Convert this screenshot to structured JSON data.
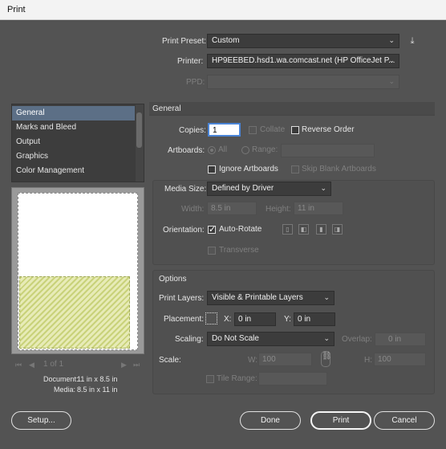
{
  "window": {
    "title": "Print"
  },
  "header": {
    "print_preset_label": "Print Preset:",
    "print_preset_value": "Custom",
    "printer_label": "Printer:",
    "printer_value": "HP9EEBED.hsd1.wa.comcast.net (HP OfficeJet P...",
    "ppd_label": "PPD:",
    "ppd_value": ""
  },
  "sidebar": {
    "items": [
      {
        "label": "General",
        "selected": true
      },
      {
        "label": "Marks and Bleed"
      },
      {
        "label": "Output"
      },
      {
        "label": "Graphics"
      },
      {
        "label": "Color Management"
      }
    ]
  },
  "preview": {
    "page_nav": "1 of 1",
    "document_label": "Document:",
    "document_value": "11 in x 8.5 in",
    "media_label": "Media:",
    "media_value": "8.5 in x 11 in"
  },
  "general": {
    "section_title": "General",
    "copies_label": "Copies:",
    "copies_value": "1",
    "collate_label": "Collate",
    "reverse_order_label": "Reverse Order",
    "artboards_label": "Artboards:",
    "all_label": "All",
    "range_label": "Range:",
    "ignore_artboards_label": "Ignore Artboards",
    "skip_blank_label": "Skip Blank Artboards",
    "media_size_label": "Media Size:",
    "media_size_value": "Defined by Driver",
    "width_label": "Width:",
    "width_value": "8.5 in",
    "height_label": "Height:",
    "height_value": "11 in",
    "orientation_label": "Orientation:",
    "auto_rotate_label": "Auto-Rotate",
    "transverse_label": "Transverse"
  },
  "options": {
    "section_title": "Options",
    "print_layers_label": "Print Layers:",
    "print_layers_value": "Visible & Printable Layers",
    "placement_label": "Placement:",
    "x_label": "X:",
    "x_value": "0 in",
    "y_label": "Y:",
    "y_value": "0 in",
    "scaling_label": "Scaling:",
    "scaling_value": "Do Not Scale",
    "overlap_label": "Overlap:",
    "overlap_value": "0 in",
    "scale_label": "Scale:",
    "w_label": "W:",
    "w_value": "100",
    "h_label": "H:",
    "h_value": "100",
    "tile_range_label": "Tile Range:"
  },
  "footer": {
    "setup_label": "Setup...",
    "done_label": "Done",
    "print_label": "Print",
    "cancel_label": "Cancel"
  }
}
